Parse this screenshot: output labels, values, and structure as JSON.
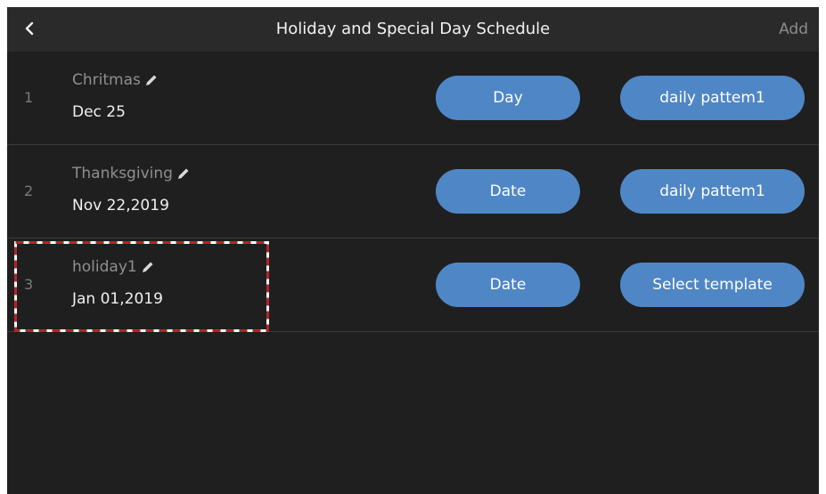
{
  "header": {
    "title": "Holiday and Special Day Schedule",
    "add_label": "Add"
  },
  "rows": [
    {
      "index": "1",
      "name": "Chritmas",
      "date": "Dec 25",
      "type": "Day",
      "template": "daily pattem1"
    },
    {
      "index": "2",
      "name": "Thanksgiving",
      "date": "Nov 22,2019",
      "type": "Date",
      "template": "daily pattem1"
    },
    {
      "index": "3",
      "name": "holiday1",
      "date": "Jan 01,2019",
      "type": "Date",
      "template": "Select template"
    }
  ],
  "colors": {
    "background": "#1f1f1f",
    "header": "#2a2a2a",
    "accent_button": "#4f86c6",
    "highlight": "#b3262a"
  },
  "icons": {
    "back": "chevron-left-icon",
    "edit": "pencil-icon"
  }
}
